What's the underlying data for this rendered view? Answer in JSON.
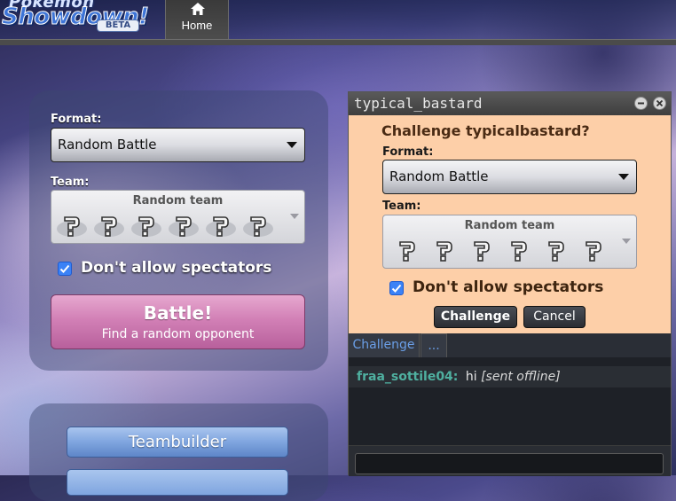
{
  "header": {
    "logo_top": "Pokémon",
    "logo_main": "Showdown!",
    "logo_badge": "BETA",
    "tabs": [
      {
        "label": "Home",
        "icon": "home-icon"
      }
    ]
  },
  "main_panel": {
    "format_label": "Format:",
    "format_value": "Random Battle",
    "team_label": "Team:",
    "team_value": "Random team",
    "spectators_label": "Don't allow spectators",
    "spectators_checked": true,
    "battle_title": "Battle!",
    "battle_subtitle": "Find a random opponent"
  },
  "secondary_panel": {
    "teambuilder_label": "Teambuilder"
  },
  "popup": {
    "title": "typical_bastard",
    "heading": "Challenge typicalbastard?",
    "format_label": "Format:",
    "format_value": "Random Battle",
    "team_label": "Team:",
    "team_value": "Random team",
    "spectators_label": "Don't allow spectators",
    "spectators_checked": true,
    "challenge_button": "Challenge",
    "cancel_button": "Cancel",
    "tabs": [
      {
        "label": "Challenge"
      },
      {
        "label": "..."
      }
    ],
    "messages": [
      {
        "user": "fraa_sottile04:",
        "text": "hi",
        "note": "[sent offline]"
      }
    ]
  },
  "colors": {
    "challenge_bg": "#fdcfa8",
    "battle_button": "#d280b6",
    "teambuilder_button": "#7fa5df",
    "chat_user": "#4fb0a0",
    "chat_tab": "#6a9ee6",
    "checkbox": "#3b82f6"
  }
}
